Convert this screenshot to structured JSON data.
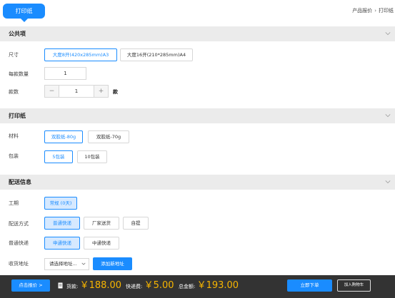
{
  "tab": {
    "label": "打印纸"
  },
  "breadcrumb": {
    "items": [
      "产品报价",
      "打印纸"
    ],
    "separator": "›"
  },
  "sections": {
    "common": {
      "title": "公共项"
    },
    "paper": {
      "title": "打印纸"
    },
    "delivery": {
      "title": "配送信息"
    }
  },
  "common": {
    "size_label": "尺寸",
    "size_options": [
      "大度8开(420x285mm)A3",
      "大度16开(210*285mm)A4"
    ],
    "per_qty_label": "每款数量",
    "per_qty_value": "1",
    "styles_label": "款数",
    "styles_value": "1",
    "styles_unit": "款",
    "minus": "−",
    "plus": "+"
  },
  "paper": {
    "material_label": "材料",
    "material_options": [
      "双胶纸-80g",
      "双胶纸-70g"
    ],
    "pack_label": "包装",
    "pack_options": [
      "5包装",
      "10包装"
    ]
  },
  "delivery": {
    "period_label": "工期",
    "period_value": "常规 (0天)",
    "method_label": "配送方式",
    "method_options": [
      "普通快递",
      "厂家送货",
      "自提"
    ],
    "express_label": "普通快递",
    "express_options": [
      "申通快递",
      "中通快递"
    ],
    "address_label": "收货地址",
    "address_placeholder": "请选择地址...",
    "add_address": "添加新地址"
  },
  "bottom": {
    "quote_button": "点击报价 >",
    "goods_label": "货款:",
    "goods_value": "￥188.00",
    "shipping_label": "快递费:",
    "shipping_value": "￥5.00",
    "total_label": "总金额:",
    "total_value": "￥193.00",
    "order_button": "立即下单",
    "cart_button": "加入购物车"
  },
  "colors": {
    "accent": "#1a8cff",
    "price": "#f7b500",
    "bar": "#333333",
    "section_bg": "#ebebeb"
  }
}
